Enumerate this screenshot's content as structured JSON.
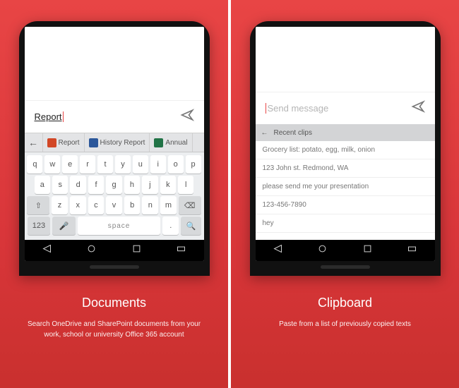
{
  "left": {
    "input_value": "Report",
    "suggestions": [
      {
        "icon": "p",
        "label": "Report"
      },
      {
        "icon": "w",
        "label": "History Report"
      },
      {
        "icon": "x",
        "label": "Annual"
      }
    ],
    "keyboard": {
      "row1": [
        "q",
        "w",
        "e",
        "r",
        "t",
        "y",
        "u",
        "i",
        "o",
        "p"
      ],
      "row2": [
        "a",
        "s",
        "d",
        "f",
        "g",
        "h",
        "j",
        "k",
        "l"
      ],
      "row3": [
        "z",
        "x",
        "c",
        "v",
        "b",
        "n",
        "m"
      ],
      "number_switch": "123",
      "space": "space",
      "period": "."
    },
    "caption_title": "Documents",
    "caption_sub": "Search OneDrive and SharePoint documents from your work, school or university Office 365 account"
  },
  "right": {
    "input_placeholder": "Send message",
    "clip_header": "Recent clips",
    "clips": [
      "Grocery list: potato, egg, milk, onion",
      "123 John st. Redmond, WA",
      "please send me your presentation",
      "123-456-7890",
      "hey"
    ],
    "caption_title": "Clipboard",
    "caption_sub": "Paste from a list of previously copied texts"
  }
}
